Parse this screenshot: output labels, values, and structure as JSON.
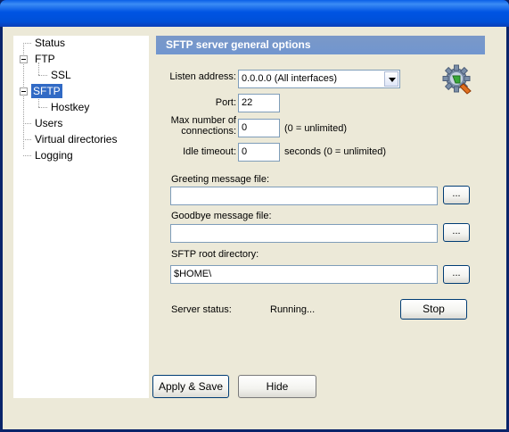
{
  "window": {
    "title": ""
  },
  "tree": {
    "items": [
      {
        "label": "Status"
      },
      {
        "label": "FTP"
      },
      {
        "label": "SSL"
      },
      {
        "label": "SFTP"
      },
      {
        "label": "Hostkey"
      },
      {
        "label": "Users"
      },
      {
        "label": "Virtual directories"
      },
      {
        "label": "Logging"
      }
    ],
    "selected": "SFTP"
  },
  "panel": {
    "header": "SFTP server general options",
    "listen_address_label": "Listen address:",
    "listen_address_value": "0.0.0.0 (All interfaces)",
    "port_label": "Port:",
    "port_value": "22",
    "max_conn_label_1": "Max number of",
    "max_conn_label_2": "connections:",
    "max_conn_value": "0",
    "max_conn_hint": "(0 = unlimited)",
    "idle_label": "Idle timeout:",
    "idle_value": "0",
    "idle_hint": "seconds (0 = unlimited)",
    "greeting_label": "Greeting message file:",
    "greeting_value": "",
    "goodbye_label": "Goodbye message file:",
    "goodbye_value": "",
    "root_label": "SFTP root directory:",
    "root_value": "$HOME\\",
    "browse_label": "...",
    "status_label": "Server status:",
    "status_value": "Running...",
    "stop_label": "Stop",
    "icon": "gear-settings-icon"
  },
  "footer": {
    "apply_label": "Apply & Save",
    "hide_label": "Hide"
  }
}
